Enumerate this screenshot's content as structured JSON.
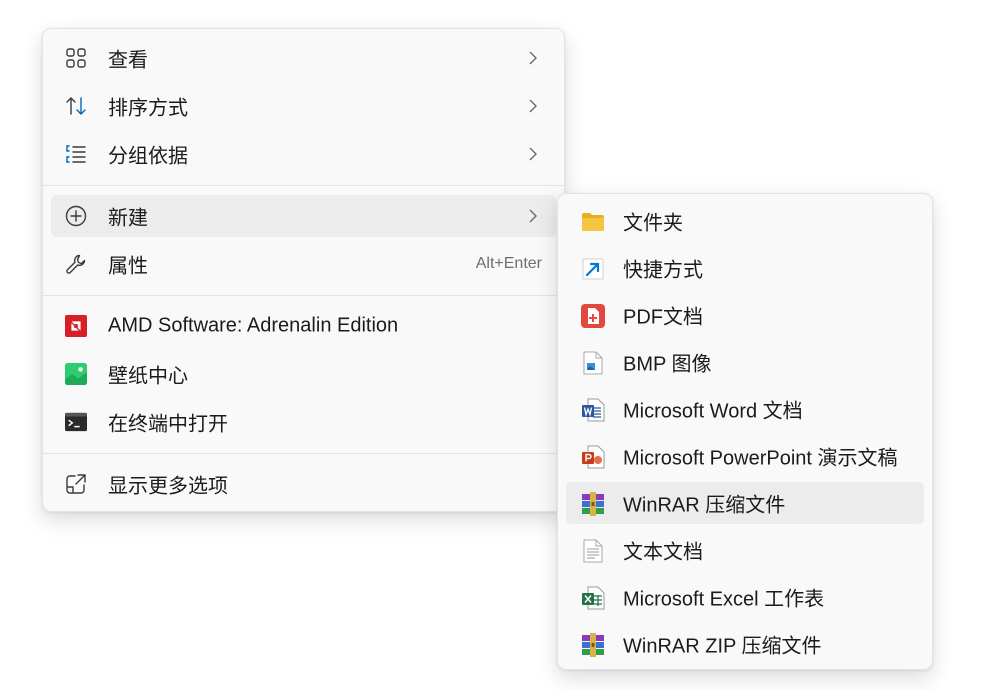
{
  "main_menu": {
    "items": [
      {
        "label": "查看",
        "icon": "grid-icon",
        "submenu": true
      },
      {
        "label": "排序方式",
        "icon": "sort-icon",
        "submenu": true
      },
      {
        "label": "分组依据",
        "icon": "group-list-icon",
        "submenu": true
      },
      {
        "label": "新建",
        "icon": "add-circle-icon",
        "submenu": true
      },
      {
        "label": "属性",
        "icon": "wrench-icon",
        "shortcut": "Alt+Enter"
      },
      {
        "label": "AMD Software: Adrenalin Edition",
        "icon": "amd-logo-icon"
      },
      {
        "label": "壁纸中心",
        "icon": "wallpaper-icon"
      },
      {
        "label": "在终端中打开",
        "icon": "terminal-icon"
      },
      {
        "label": "显示更多选项",
        "icon": "open-external-icon"
      }
    ]
  },
  "new_submenu": {
    "items": [
      {
        "label": "文件夹",
        "icon": "folder-icon"
      },
      {
        "label": "快捷方式",
        "icon": "shortcut-arrow-icon"
      },
      {
        "label": "PDF文档",
        "icon": "pdf-icon"
      },
      {
        "label": "BMP 图像",
        "icon": "bmp-image-icon"
      },
      {
        "label": "Microsoft Word 文档",
        "icon": "word-icon"
      },
      {
        "label": "Microsoft PowerPoint 演示文稿",
        "icon": "powerpoint-icon"
      },
      {
        "label": "WinRAR 压缩文件",
        "icon": "winrar-icon"
      },
      {
        "label": "文本文档",
        "icon": "text-document-icon"
      },
      {
        "label": "Microsoft Excel 工作表",
        "icon": "excel-icon"
      },
      {
        "label": "WinRAR ZIP 压缩文件",
        "icon": "winrar-zip-icon"
      }
    ]
  },
  "colors": {
    "hover": "#ececec",
    "accent_blue": "#0067c0",
    "amd_red": "#d61f26",
    "wallpaper_green": "#2ecc71",
    "pdf_red": "#e2483d",
    "word_blue": "#2b579a",
    "powerpoint_orange": "#c43e1c",
    "excel_green": "#217346",
    "folder_yellow": "#f4c542"
  }
}
